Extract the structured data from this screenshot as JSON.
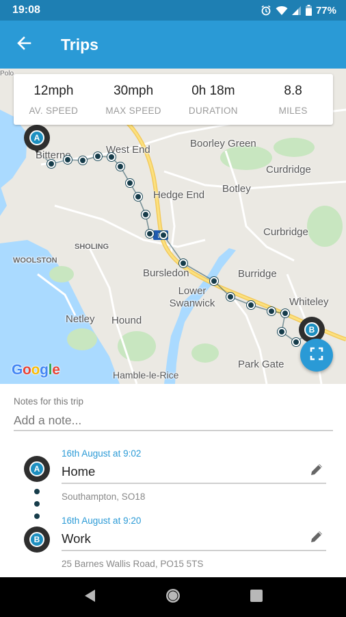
{
  "status_bar": {
    "time": "19:08",
    "battery": "77%",
    "icons": [
      "alarm-icon",
      "wifi-icon",
      "signal-icon",
      "battery-icon"
    ]
  },
  "app_bar": {
    "title": "Trips",
    "back_icon": "arrow-back-icon"
  },
  "stats": [
    {
      "value": "12mph",
      "label": "AV. SPEED"
    },
    {
      "value": "30mph",
      "label": "MAX SPEED"
    },
    {
      "value": "0h 18m",
      "label": "DURATION"
    },
    {
      "value": "8.8",
      "label": "MILES"
    }
  ],
  "map": {
    "places": [
      "Bitterne",
      "West End",
      "Boorley Green",
      "Curdridge",
      "Botley",
      "Hedge End",
      "SHOLING",
      "WOOLSTON",
      "Curbridge",
      "Bursledon",
      "Burridge",
      "Lower Swanwick",
      "Whiteley",
      "Netley",
      "Hound",
      "Park Gate",
      "Hamble-le-Rice",
      "Polo"
    ],
    "start_marker": "A",
    "end_marker": "B",
    "attribution": "Google",
    "fullscreen_icon": "fullscreen-icon",
    "route_color": "#163c4a"
  },
  "notes": {
    "label": "Notes for this trip",
    "placeholder": "Add a note..."
  },
  "stops": [
    {
      "marker": "A",
      "time": "16th August at 9:02",
      "name": "Home",
      "address": "Southampton, SO18"
    },
    {
      "marker": "B",
      "time": "16th August at 9:20",
      "name": "Work",
      "address": "25 Barnes Wallis Road, PO15 5TS"
    }
  ],
  "nav": [
    "back-triangle-icon",
    "home-circle-icon",
    "recents-square-icon"
  ],
  "colors": {
    "primary": "#2a9ad6",
    "primary_dark": "#1e7fb3",
    "accent_link": "#2a9ad6"
  }
}
